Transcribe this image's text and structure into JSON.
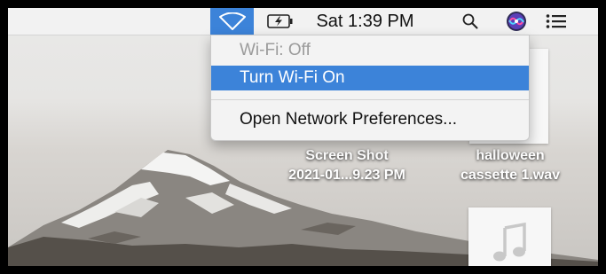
{
  "menubar": {
    "clock": "Sat 1:39 PM",
    "icons": [
      "wifi-icon",
      "battery-charging-icon",
      "search-icon",
      "siri-icon",
      "list-icon"
    ]
  },
  "wifi_menu": {
    "status": "Wi-Fi: Off",
    "turn_on": "Turn Wi-Fi On",
    "preferences": "Open Network Preferences..."
  },
  "desktop": {
    "files": [
      {
        "line1": "Screen Shot",
        "line2": "2021-01...9.23 PM"
      },
      {
        "line1": "halloween",
        "line2": "cassette 1.wav"
      }
    ],
    "music_file_icon": "music-note-icon"
  },
  "colors": {
    "accent": "#3c83d9",
    "menubar": "#f2f2f2",
    "disabled_text": "#9b9b9b"
  }
}
